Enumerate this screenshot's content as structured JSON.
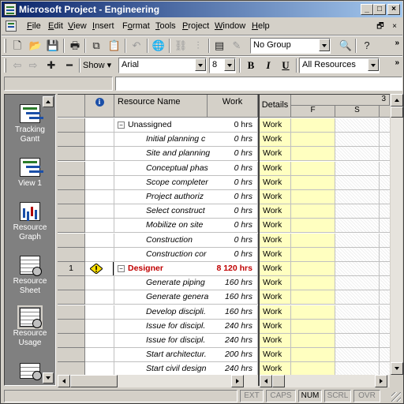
{
  "window": {
    "title": "Microsoft Project - Engineering",
    "controls": {
      "minimize": "_",
      "maximize": "□",
      "close": "×"
    }
  },
  "menubar": {
    "items": [
      "File",
      "Edit",
      "View",
      "Insert",
      "Format",
      "Tools",
      "Project",
      "Window",
      "Help"
    ],
    "accelerators": [
      "F",
      "E",
      "V",
      "I",
      "o",
      "T",
      "P",
      "W",
      "H"
    ]
  },
  "standard_toolbar": {
    "group_value": "No Group",
    "icons": [
      "new-icon",
      "open-icon",
      "save-icon",
      "print-icon",
      "copy-icon",
      "paste-icon",
      "undo-icon",
      "hyperlink-icon",
      "link-tasks-icon",
      "unlink-tasks-icon",
      "task-information-icon",
      "notes-icon",
      "zoom-out-icon",
      "help-icon"
    ]
  },
  "formatting_toolbar": {
    "show_label": "Show",
    "font_value": "Arial",
    "size_value": "8",
    "bold": "B",
    "italic": "I",
    "underline": "U",
    "filter_value": "All Resources",
    "icons": [
      "outdent-icon",
      "indent-icon",
      "show-subtasks-icon",
      "hide-subtasks-icon"
    ]
  },
  "view_bar": {
    "items": [
      {
        "label": "Tracking Gantt",
        "icon": "tracking-gantt-icon"
      },
      {
        "label": "View 1",
        "icon": "view-1-icon"
      },
      {
        "label": "Resource Graph",
        "icon": "resource-graph-icon"
      },
      {
        "label": "Resource Sheet",
        "icon": "resource-sheet-icon"
      },
      {
        "label": "Resource Usage",
        "icon": "resource-usage-icon"
      }
    ],
    "selected": "Resource Usage"
  },
  "grid": {
    "columns": {
      "indicator_icon": "info-icon",
      "name": "Resource Name",
      "work": "Work"
    },
    "rows": [
      {
        "id": "",
        "name": "Unassigned",
        "work": "0 hrs",
        "type": "resource",
        "collapse": "⊟"
      },
      {
        "id": "",
        "name": "Initial planning c",
        "work": "0 hrs",
        "type": "task"
      },
      {
        "id": "",
        "name": "Site and planning",
        "work": "0 hrs",
        "type": "task"
      },
      {
        "id": "",
        "name": "Conceptual phas",
        "work": "0 hrs",
        "type": "task"
      },
      {
        "id": "",
        "name": "Scope completer",
        "work": "0 hrs",
        "type": "task"
      },
      {
        "id": "",
        "name": "Project authoriz",
        "work": "0 hrs",
        "type": "task"
      },
      {
        "id": "",
        "name": "Select construct",
        "work": "0 hrs",
        "type": "task"
      },
      {
        "id": "",
        "name": "Mobilize on site",
        "work": "0 hrs",
        "type": "task"
      },
      {
        "id": "",
        "name": "Construction",
        "work": "0 hrs",
        "type": "task"
      },
      {
        "id": "",
        "name": "Construction cor",
        "work": "0 hrs",
        "type": "task"
      },
      {
        "id": "1",
        "name": "Designer",
        "work": "8 120 hrs",
        "type": "resource-overallocated",
        "indicator": "warning-icon",
        "collapse": "⊟"
      },
      {
        "id": "",
        "name": "Generate piping",
        "work": "160 hrs",
        "type": "task"
      },
      {
        "id": "",
        "name": "Generate genera",
        "work": "160 hrs",
        "type": "task"
      },
      {
        "id": "",
        "name": "Develop discipli.",
        "work": "160 hrs",
        "type": "task"
      },
      {
        "id": "",
        "name": "Issue for discipl.",
        "work": "240 hrs",
        "type": "task"
      },
      {
        "id": "",
        "name": "Issue for discipl.",
        "work": "240 hrs",
        "type": "task"
      },
      {
        "id": "",
        "name": "Start architectur.",
        "work": "200 hrs",
        "type": "task"
      },
      {
        "id": "",
        "name": "Start civil design",
        "work": "240 hrs",
        "type": "task"
      }
    ]
  },
  "timescale": {
    "details_label": "Details",
    "top_tier_fragment": "3",
    "days": [
      "F",
      "S"
    ],
    "detail_value": "Work"
  },
  "statusbar": {
    "indicators": [
      {
        "label": "EXT",
        "active": false
      },
      {
        "label": "CAPS",
        "active": false
      },
      {
        "label": "NUM",
        "active": true
      },
      {
        "label": "SCRL",
        "active": false
      },
      {
        "label": "OVR",
        "active": false
      }
    ]
  },
  "colors": {
    "title_gradient_start": "#0a246a",
    "title_gradient_end": "#a6caf0",
    "chrome": "#d4d0c8",
    "overallocated_text": "#c00000",
    "details_fill": "#ffffc0",
    "viewbar_bg": "#808080"
  }
}
